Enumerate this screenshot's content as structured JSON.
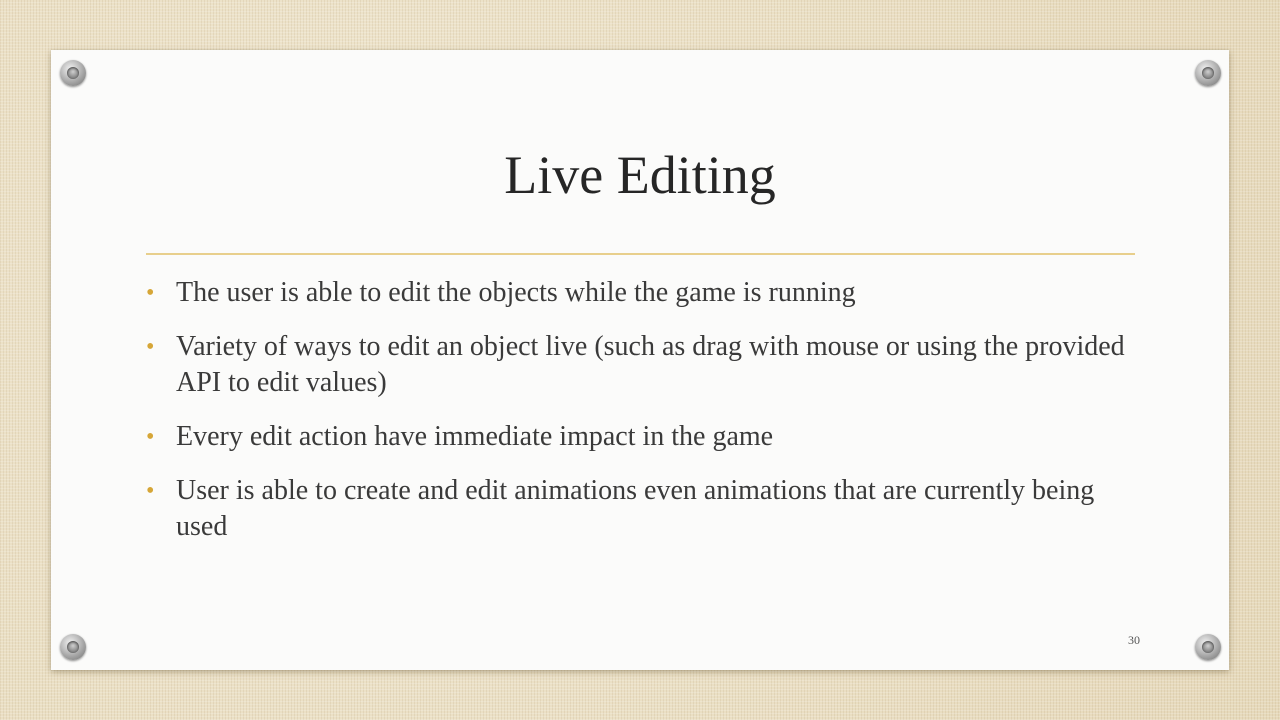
{
  "slide": {
    "title": "Live Editing",
    "bullets": [
      "The user is able to edit the objects while the game is running",
      "Variety of ways to edit an object live (such as drag with mouse or using the provided API to edit values)",
      "Every edit action have immediate impact in the game",
      "User is able to create and edit animations even animations that are currently being used"
    ],
    "bullet_symbol": "•",
    "page_number": "30"
  },
  "colors": {
    "background": "#eadfc4",
    "slide": "#fbfbfa",
    "accent_rule": "#e8cf8c",
    "bullet": "#d6a637",
    "title_text": "#262626",
    "body_text": "#3a3a3a"
  },
  "icons": {
    "pins": [
      "pushpin-icon",
      "pushpin-icon",
      "pushpin-icon",
      "pushpin-icon"
    ]
  }
}
